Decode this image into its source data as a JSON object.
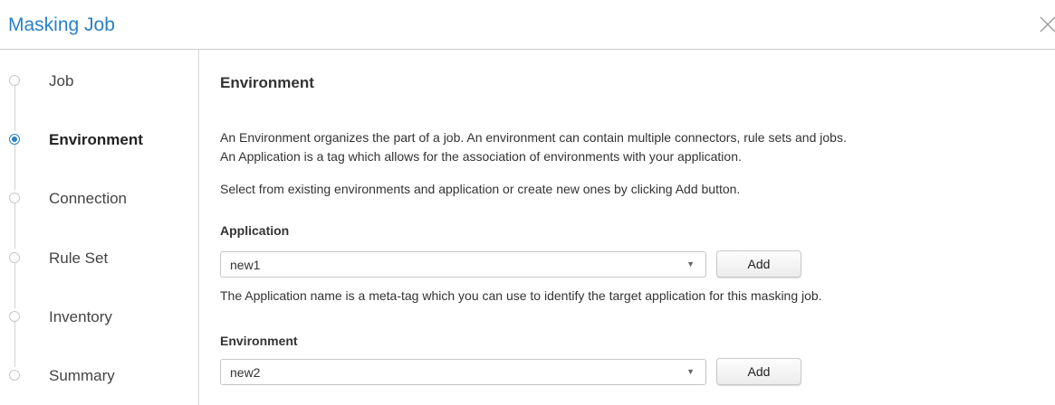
{
  "dialog": {
    "title": "Masking Job",
    "close_icon": "close-icon"
  },
  "steps": [
    {
      "label": "Job",
      "active": false
    },
    {
      "label": "Environment",
      "active": true
    },
    {
      "label": "Connection",
      "active": false
    },
    {
      "label": "Rule Set",
      "active": false
    },
    {
      "label": "Inventory",
      "active": false
    },
    {
      "label": "Summary",
      "active": false
    }
  ],
  "main": {
    "title": "Environment",
    "description_line1": "An Environment organizes the part of a job. An environment can contain multiple connectors, rule sets and jobs.",
    "description_line2": "An Application is a tag which allows for the association of environments with your application.",
    "instructions": "Select from existing environments and application or create new ones by clicking Add button.",
    "application": {
      "label": "Application",
      "selected": "new1",
      "add_label": "Add",
      "help": "The Application name is a meta-tag which you can use to identify the target application for this masking job."
    },
    "environment": {
      "label": "Environment",
      "selected": "new2",
      "add_label": "Add"
    }
  },
  "colors": {
    "accent": "#2a80c5",
    "divider": "#cccccc"
  }
}
